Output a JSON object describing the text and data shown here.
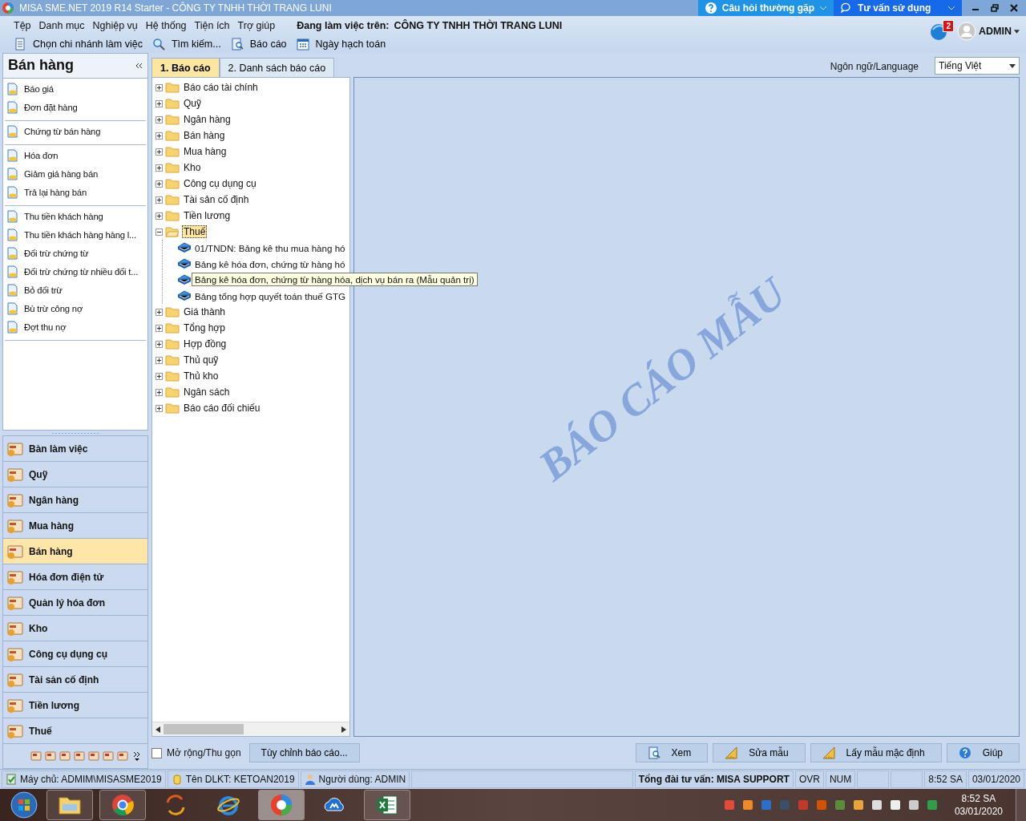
{
  "window": {
    "title": "MISA SME.NET 2019 R14 Starter - CÔNG TY TNHH THỜI TRANG LUNI",
    "help_buttons": [
      {
        "label": "Câu hỏi thường gặp",
        "kind": "faq"
      },
      {
        "label": "Tư vấn sử dụng",
        "kind": "chat"
      }
    ]
  },
  "menu": [
    "Tệp",
    "Danh mục",
    "Nghiệp vụ",
    "Hệ thống",
    "Tiện ích",
    "Trợ giúp"
  ],
  "working_on": {
    "label": "Đang làm việc trên:",
    "company": "CÔNG TY TNHH THỜI TRANG LUNI"
  },
  "toolbar": [
    {
      "label": "Chọn chi nhánh làm việc",
      "kind": "document"
    },
    {
      "label": "Tìm kiếm...",
      "kind": "search"
    },
    {
      "label": "Báo cáo",
      "kind": "report"
    },
    {
      "label": "Ngày hạch toán",
      "kind": "calendar"
    }
  ],
  "notifications": {
    "badge": "2"
  },
  "user": {
    "name": "ADMIN"
  },
  "sidebar": {
    "title": "Bán hàng",
    "groups": [
      {
        "items": [
          "Báo giá",
          "Đơn đặt hàng"
        ]
      },
      {
        "items": [
          "Chứng từ bán hàng"
        ]
      },
      {
        "items": [
          "Hóa đơn",
          "Giảm giá hàng bán",
          "Trả lại hàng bán"
        ]
      },
      {
        "items": [
          "Thu tiền khách hàng",
          "Thu tiền khách hàng hàng l...",
          "Đối trừ chứng từ",
          "Đối trừ chứng từ nhiều đối t...",
          "Bỏ đối trừ",
          "Bù trừ công nợ",
          "Đợt thu nợ"
        ]
      }
    ]
  },
  "modules": [
    {
      "label": "Bàn làm việc",
      "selected": false
    },
    {
      "label": "Quỹ",
      "selected": false
    },
    {
      "label": "Ngân hàng",
      "selected": false
    },
    {
      "label": "Mua hàng",
      "selected": false
    },
    {
      "label": "Bán hàng",
      "selected": true
    },
    {
      "label": "Hóa đơn điện tử",
      "selected": false
    },
    {
      "label": "Quản lý hóa đơn",
      "selected": false
    },
    {
      "label": "Kho",
      "selected": false
    },
    {
      "label": "Công cụ dụng cụ",
      "selected": false
    },
    {
      "label": "Tài sản cố định",
      "selected": false
    },
    {
      "label": "Tiền lương",
      "selected": false
    },
    {
      "label": "Thuế",
      "selected": false
    }
  ],
  "tabs": [
    {
      "label": "1. Báo cáo",
      "selected": true
    },
    {
      "label": "2. Danh sách báo cáo",
      "selected": false
    }
  ],
  "language": {
    "label": "Ngôn ngữ/Language",
    "value": "Tiếng Việt"
  },
  "tree": [
    {
      "label": "Báo cáo tài chính",
      "expanded": false,
      "selected": false
    },
    {
      "label": "Quỹ",
      "expanded": false,
      "selected": false
    },
    {
      "label": "Ngân hàng",
      "expanded": false,
      "selected": false
    },
    {
      "label": "Bán hàng",
      "expanded": false,
      "selected": false
    },
    {
      "label": "Mua hàng",
      "expanded": false,
      "selected": false
    },
    {
      "label": "Kho",
      "expanded": false,
      "selected": false
    },
    {
      "label": "Công cụ dụng cụ",
      "expanded": false,
      "selected": false
    },
    {
      "label": "Tài sản cố định",
      "expanded": false,
      "selected": false
    },
    {
      "label": "Tiền lương",
      "expanded": false,
      "selected": false
    },
    {
      "label": "Thuế",
      "expanded": true,
      "selected": true,
      "children": [
        {
          "label": "01/TNDN: Bảng kê thu mua hàng hó"
        },
        {
          "label": "Bảng kê hóa đơn, chứng từ hàng hó"
        },
        {
          "tooltip": "Bảng kê hóa đơn, chứng từ hàng hóa, dịch vụ bán ra (Mẫu quản trị)"
        },
        {
          "label": "Bảng tổng hợp quyết toán thuế GTG"
        }
      ]
    },
    {
      "label": "Giá thành",
      "expanded": false,
      "selected": false
    },
    {
      "label": "Tổng hợp",
      "expanded": false,
      "selected": false
    },
    {
      "label": "Hợp đồng",
      "expanded": false,
      "selected": false
    },
    {
      "label": "Thủ quỹ",
      "expanded": false,
      "selected": false
    },
    {
      "label": "Thủ kho",
      "expanded": false,
      "selected": false
    },
    {
      "label": "Ngân sách",
      "expanded": false,
      "selected": false
    },
    {
      "label": "Báo cáo đối chiếu",
      "expanded": false,
      "selected": false
    }
  ],
  "preview": {
    "stamp": "BÁO CÁO MẪU"
  },
  "expand_toggle": {
    "label": "Mở rộng/Thu gọn",
    "checked": false
  },
  "customize_button": "Tùy chỉnh báo cáo...",
  "actions": [
    {
      "label": "Xem",
      "kind": "report"
    },
    {
      "label": "Sửa mẫu",
      "kind": "ruler"
    },
    {
      "label": "Lấy mẫu mặc định",
      "kind": "ruler"
    },
    {
      "label": "Giúp",
      "kind": "help"
    }
  ],
  "status_bar": [
    {
      "text": "Máy chủ: ADMIM\\MISASME2019",
      "kind": "server"
    },
    {
      "text": "Tên DLKT: KETOAN2019",
      "kind": "database"
    },
    {
      "text": "Người dùng: ADMIN",
      "kind": "user"
    },
    {
      "text": "Tổng đài tư vấn: MISA SUPPORT",
      "kind": "hotline"
    },
    {
      "text": "OVR",
      "kind": "plain"
    },
    {
      "text": "NUM",
      "kind": "plain"
    },
    {
      "text": "8:52 SA",
      "kind": "plain"
    },
    {
      "text": "03/01/2020",
      "kind": "plain"
    }
  ],
  "taskbar": {
    "apps": [
      {
        "kind": "folder",
        "running": true,
        "selected": false
      },
      {
        "kind": "chrome",
        "running": true,
        "selected": false
      },
      {
        "kind": "sync",
        "running": false,
        "selected": false
      },
      {
        "kind": "browser",
        "running": false,
        "selected": false
      },
      {
        "kind": "misa",
        "running": true,
        "selected": true
      },
      {
        "kind": "cloud",
        "running": false,
        "selected": false
      },
      {
        "kind": "sheet",
        "running": true,
        "selected": false
      }
    ],
    "time": "8:52 SA",
    "date": "03/01/2020"
  }
}
